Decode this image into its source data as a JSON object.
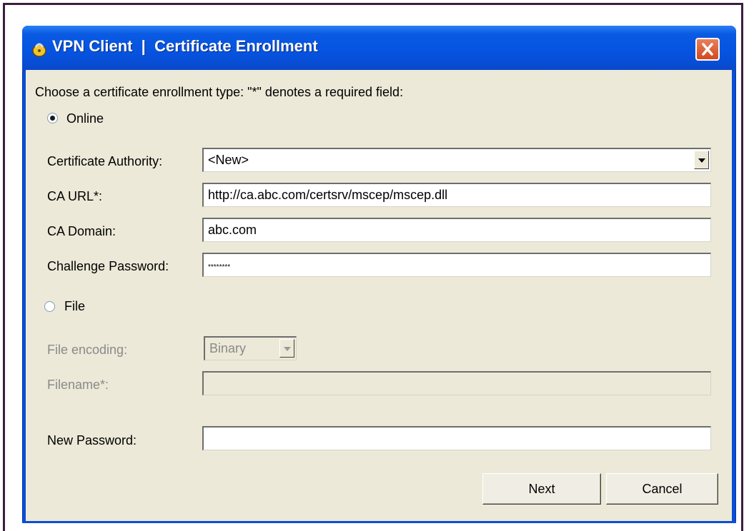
{
  "window": {
    "title": "VPN Client  |  Certificate Enrollment",
    "title_icon": "lock-icon",
    "close_icon": "close-icon"
  },
  "form": {
    "instruction": "Choose a certificate enrollment type:  \"*\" denotes a required field:",
    "online_label": "Online",
    "online_selected": true,
    "certificate_authority": {
      "label": "Certificate Authority:",
      "value": "<New>"
    },
    "ca_url": {
      "label": "CA URL*:",
      "value": "http://ca.abc.com/certsrv/mscep/mscep.dll"
    },
    "ca_domain": {
      "label": "CA Domain:",
      "value": "abc.com"
    },
    "challenge_password": {
      "label": "Challenge Password:",
      "value": "********"
    },
    "file_label": "File",
    "file_selected": false,
    "file_encoding": {
      "label": "File encoding:",
      "value": "Binary"
    },
    "filename": {
      "label": "Filename*:",
      "value": ""
    },
    "new_password": {
      "label": "New Password:",
      "value": ""
    }
  },
  "buttons": {
    "next": "Next",
    "cancel": "Cancel"
  },
  "colors": {
    "titlebar": "#0553e0",
    "client_bg": "#ece9d8",
    "close_button": "#d24a1d"
  }
}
